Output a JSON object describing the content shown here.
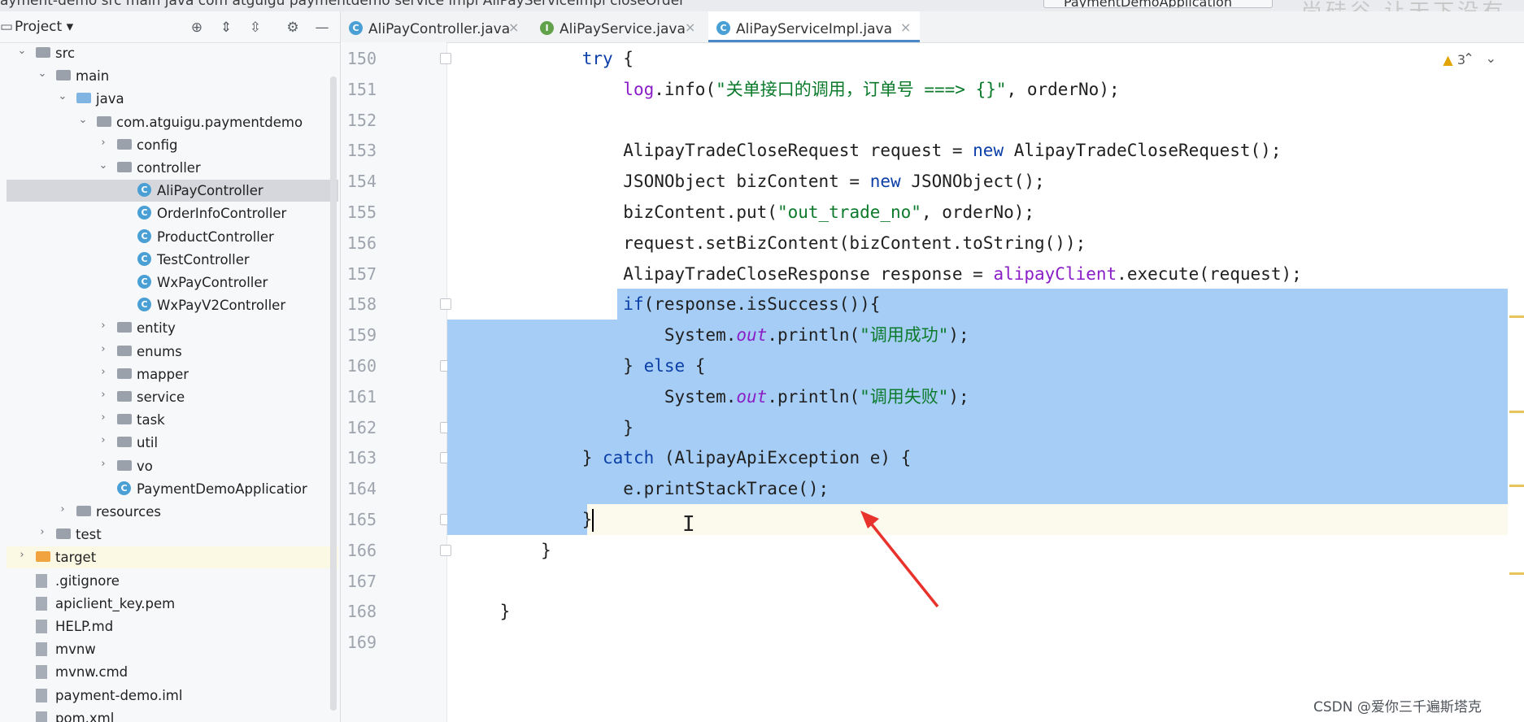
{
  "topbar": {
    "breadcrumb": "ayment-demo  src  main  java  com  atguigu  paymentdemo  service  impl  AliPayServiceImpl  closeOrder",
    "run_config": "PaymentDemoApplication",
    "watermark_top": "尚硅谷 让天下没有难学的"
  },
  "project_panel": {
    "title": "Project",
    "tree": [
      {
        "label": "src",
        "icon": "folder-icon",
        "color": "gray",
        "depth": 0,
        "arrow": "expanded"
      },
      {
        "label": "main",
        "icon": "folder-icon",
        "color": "gray",
        "depth": 1,
        "arrow": "expanded"
      },
      {
        "label": "java",
        "icon": "folder-icon",
        "color": "blue",
        "depth": 2,
        "arrow": "expanded"
      },
      {
        "label": "com.atguigu.paymentdemo",
        "icon": "package-icon",
        "color": "gray",
        "depth": 3,
        "arrow": "expanded"
      },
      {
        "label": "config",
        "icon": "folder-icon",
        "color": "gray",
        "depth": 4,
        "arrow": "collapsed"
      },
      {
        "label": "controller",
        "icon": "folder-icon",
        "color": "gray",
        "depth": 4,
        "arrow": "expanded"
      },
      {
        "label": "AliPayController",
        "icon": "class-icon",
        "depth": 5,
        "arrow": "none",
        "selected": true
      },
      {
        "label": "OrderInfoController",
        "icon": "class-icon",
        "depth": 5,
        "arrow": "none"
      },
      {
        "label": "ProductController",
        "icon": "class-icon",
        "depth": 5,
        "arrow": "none"
      },
      {
        "label": "TestController",
        "icon": "class-icon",
        "depth": 5,
        "arrow": "none"
      },
      {
        "label": "WxPayController",
        "icon": "class-icon",
        "depth": 5,
        "arrow": "none"
      },
      {
        "label": "WxPayV2Controller",
        "icon": "class-icon",
        "depth": 5,
        "arrow": "none"
      },
      {
        "label": "entity",
        "icon": "folder-icon",
        "color": "gray",
        "depth": 4,
        "arrow": "collapsed"
      },
      {
        "label": "enums",
        "icon": "folder-icon",
        "color": "gray",
        "depth": 4,
        "arrow": "collapsed"
      },
      {
        "label": "mapper",
        "icon": "folder-icon",
        "color": "gray",
        "depth": 4,
        "arrow": "collapsed"
      },
      {
        "label": "service",
        "icon": "folder-icon",
        "color": "gray",
        "depth": 4,
        "arrow": "collapsed"
      },
      {
        "label": "task",
        "icon": "folder-icon",
        "color": "gray",
        "depth": 4,
        "arrow": "collapsed"
      },
      {
        "label": "util",
        "icon": "folder-icon",
        "color": "gray",
        "depth": 4,
        "arrow": "collapsed"
      },
      {
        "label": "vo",
        "icon": "folder-icon",
        "color": "gray",
        "depth": 4,
        "arrow": "collapsed"
      },
      {
        "label": "PaymentDemoApplicatior",
        "icon": "spring-class-icon",
        "depth": 4,
        "arrow": "none"
      },
      {
        "label": "resources",
        "icon": "folder-icon",
        "color": "gray",
        "depth": 2,
        "arrow": "collapsed"
      },
      {
        "label": "test",
        "icon": "folder-icon",
        "color": "gray",
        "depth": 1,
        "arrow": "collapsed"
      },
      {
        "label": "target",
        "icon": "folder-icon",
        "color": "orange",
        "depth": 0,
        "arrow": "collapsed",
        "highlight": true
      },
      {
        "label": ".gitignore",
        "icon": "file-icon",
        "depth": 0,
        "arrow": "none"
      },
      {
        "label": "apiclient_key.pem",
        "icon": "file-icon",
        "depth": 0,
        "arrow": "none"
      },
      {
        "label": "HELP.md",
        "icon": "markdown-icon",
        "depth": 0,
        "arrow": "none"
      },
      {
        "label": "mvnw",
        "icon": "file-icon",
        "depth": 0,
        "arrow": "none"
      },
      {
        "label": "mvnw.cmd",
        "icon": "file-icon",
        "depth": 0,
        "arrow": "none"
      },
      {
        "label": "payment-demo.iml",
        "icon": "file-icon",
        "depth": 0,
        "arrow": "none"
      },
      {
        "label": "pom.xml",
        "icon": "maven-icon",
        "depth": 0,
        "arrow": "none"
      }
    ]
  },
  "tabs": [
    {
      "label": "AliPayController.java",
      "icon": "class-icon",
      "icon_letter": "C",
      "color": "#4a9fd5",
      "active": false
    },
    {
      "label": "AliPayService.java",
      "icon": "interface-icon",
      "icon_letter": "I",
      "color": "#62a24b",
      "active": false
    },
    {
      "label": "AliPayServiceImpl.java",
      "icon": "class-icon",
      "icon_letter": "C",
      "color": "#4a9fd5",
      "active": true
    }
  ],
  "inspections": {
    "warnings": "3"
  },
  "code": {
    "current_line": "165",
    "lines": [
      {
        "n": "150",
        "tokens": [
          [
            "            ",
            ""
          ],
          [
            "try",
            "kw"
          ],
          [
            " {",
            ""
          ]
        ]
      },
      {
        "n": "151",
        "tokens": [
          [
            "                ",
            ""
          ],
          [
            "log",
            "fld"
          ],
          [
            ".info(",
            ""
          ],
          [
            "\"关单接口的调用，订单号 ===> {}\"",
            "str"
          ],
          [
            ", orderNo);",
            ""
          ]
        ]
      },
      {
        "n": "152",
        "tokens": [
          [
            "",
            ""
          ]
        ]
      },
      {
        "n": "153",
        "tokens": [
          [
            "                AlipayTradeCloseRequest request = ",
            ""
          ],
          [
            "new",
            "kw"
          ],
          [
            " AlipayTradeCloseRequest();",
            ""
          ]
        ]
      },
      {
        "n": "154",
        "tokens": [
          [
            "                JSONObject bizContent = ",
            ""
          ],
          [
            "new",
            "kw"
          ],
          [
            " JSONObject();",
            ""
          ]
        ]
      },
      {
        "n": "155",
        "tokens": [
          [
            "                bizContent.put(",
            ""
          ],
          [
            "\"out_trade_no\"",
            "str"
          ],
          [
            ", orderNo);",
            ""
          ]
        ]
      },
      {
        "n": "156",
        "tokens": [
          [
            "                request.setBizContent(bizContent.toString());",
            ""
          ]
        ]
      },
      {
        "n": "157",
        "tokens": [
          [
            "                AlipayTradeCloseResponse response = ",
            ""
          ],
          [
            "alipayClient",
            "fld"
          ],
          [
            ".execute(request);",
            ""
          ]
        ]
      },
      {
        "n": "158",
        "tokens": [
          [
            "                ",
            ""
          ],
          [
            "if",
            "kw"
          ],
          [
            "(response.isSuccess()){",
            ""
          ]
        ]
      },
      {
        "n": "159",
        "tokens": [
          [
            "                    System.",
            ""
          ],
          [
            "out",
            "itl"
          ],
          [
            ".println(",
            ""
          ],
          [
            "\"调用成功\"",
            "str"
          ],
          [
            ");",
            ""
          ]
        ]
      },
      {
        "n": "160",
        "tokens": [
          [
            "                } ",
            ""
          ],
          [
            "else",
            "kw"
          ],
          [
            " {",
            ""
          ]
        ]
      },
      {
        "n": "161",
        "tokens": [
          [
            "                    System.",
            ""
          ],
          [
            "out",
            "itl"
          ],
          [
            ".println(",
            ""
          ],
          [
            "\"调用失败\"",
            "str"
          ],
          [
            ");",
            ""
          ]
        ]
      },
      {
        "n": "162",
        "tokens": [
          [
            "                }",
            ""
          ]
        ]
      },
      {
        "n": "163",
        "tokens": [
          [
            "            } ",
            ""
          ],
          [
            "catch",
            "kw"
          ],
          [
            " (AlipayApiException e) {",
            ""
          ]
        ]
      },
      {
        "n": "164",
        "tokens": [
          [
            "                e.printStackTrace();",
            ""
          ]
        ]
      },
      {
        "n": "165",
        "tokens": [
          [
            "            }",
            ""
          ],
          [
            "|",
            "caret"
          ]
        ]
      },
      {
        "n": "166",
        "tokens": [
          [
            "        }",
            ""
          ]
        ]
      },
      {
        "n": "167",
        "tokens": [
          [
            "",
            ""
          ]
        ]
      },
      {
        "n": "168",
        "tokens": [
          [
            "    }",
            ""
          ]
        ]
      },
      {
        "n": "169",
        "tokens": [
          [
            "",
            ""
          ]
        ]
      }
    ]
  },
  "annotation": {
    "arrow_color": "#e8322c"
  },
  "watermark": "CSDN @爱你三千遍斯塔克"
}
